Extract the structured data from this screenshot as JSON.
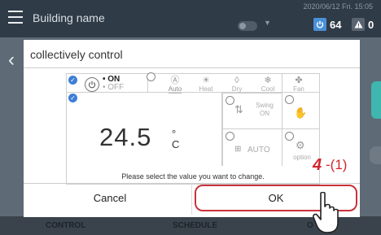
{
  "header": {
    "building_name": "Building name",
    "datetime": "2020/06/12 Fri. 15:05",
    "on_count": "64",
    "alarm_count": "0"
  },
  "nav": {
    "control": "CONTROL",
    "schedule": "SCHEDULE",
    "other": "O"
  },
  "dialog": {
    "title": "collectively control",
    "power": {
      "on": "• ON",
      "off": "• OFF"
    },
    "modes": [
      {
        "label": "Auto",
        "icon": "auto-mode-icon"
      },
      {
        "label": "Heat",
        "icon": "sun-icon"
      },
      {
        "label": "Dry",
        "icon": "droplet-icon"
      },
      {
        "label": "Cool",
        "icon": "snowflake-icon"
      },
      {
        "label": "Fan",
        "icon": "fan-icon"
      }
    ],
    "temperature": "24.5",
    "temperature_unit": "°C",
    "swing": "Swing",
    "swing_state": "ON",
    "fan_speed": "AUTO",
    "option": "option",
    "instruction": "Please select the value you want to change.",
    "cancel": "Cancel",
    "ok": "OK"
  },
  "annotation": {
    "step": "4",
    "sub": "-(1)"
  },
  "colors": {
    "accent": "#3d7fd6",
    "highlight": "#c8323b",
    "topbar": "#2f3b47"
  }
}
